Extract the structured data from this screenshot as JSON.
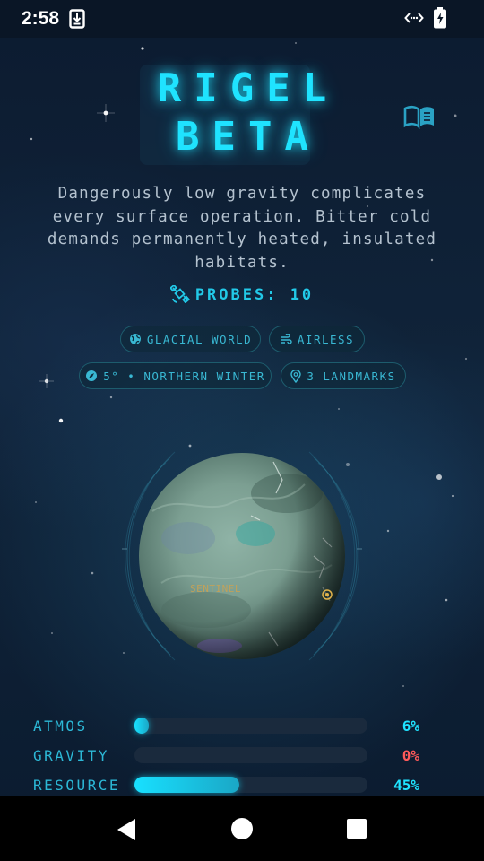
{
  "status_bar": {
    "time": "2:58",
    "icons": [
      "download-notification-icon",
      "data-transfer-icon",
      "battery-charging-icon"
    ]
  },
  "planet": {
    "name_line1": "RIGEL",
    "name_line2": "BETA",
    "description": "Dangerously low gravity complicates every surface operation. Bitter cold demands permanently heated, insulated habitats.",
    "probes_label": "PROBES: 10",
    "tags": [
      {
        "icon": "globe-icon",
        "label": "GLACIAL WORLD"
      },
      {
        "icon": "wind-icon",
        "label": "AIRLESS"
      },
      {
        "icon": "compass-icon",
        "label": "5° • NORTHERN WINTER"
      },
      {
        "icon": "map-pin-icon",
        "label": "3 LANDMARKS"
      }
    ],
    "landmark_label": "SENTINEL"
  },
  "stats": [
    {
      "label": "ATMOS",
      "value": "6%",
      "fraction": 0.06,
      "color": "#1fe3ff"
    },
    {
      "label": "GRAVITY",
      "value": "0%",
      "fraction": 0.0,
      "color": "#ff5a5a"
    },
    {
      "label": "RESOURCE",
      "value": "45%",
      "fraction": 0.45,
      "color": "#1fe3ff"
    }
  ],
  "colors": {
    "accent": "#1fe3ff",
    "chip_text": "#39b8d3",
    "description_text": "#b4c2cf",
    "warning": "#ff5a5a",
    "background": "#0c1b30"
  },
  "nav": {
    "icons": [
      "back-icon",
      "home-icon",
      "recents-icon"
    ]
  }
}
